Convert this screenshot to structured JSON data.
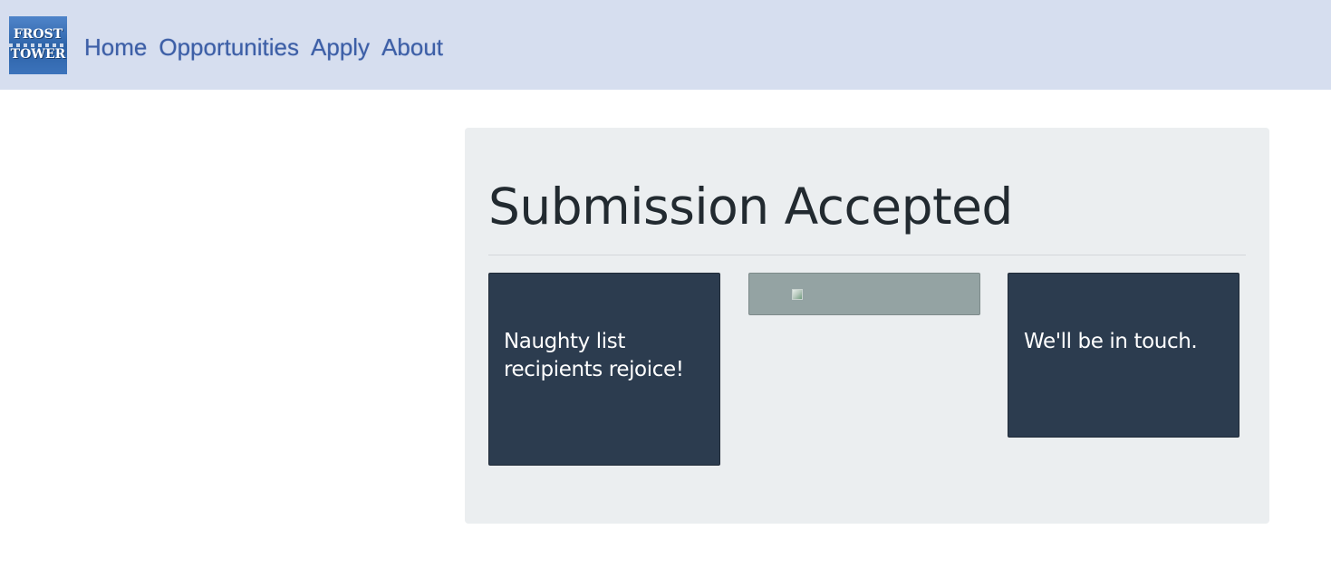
{
  "header": {
    "logo": {
      "line1": "FROST",
      "line2": "TOWER"
    },
    "nav": [
      "Home",
      "Opportunities",
      "Apply",
      "About"
    ]
  },
  "main": {
    "title": "Submission Accepted",
    "cards": [
      {
        "text": "Naughty list recipients rejoice!"
      },
      {
        "text": "We'll be in touch."
      }
    ],
    "image": {
      "alt": ""
    }
  },
  "colors": {
    "navbar_bg": "#d6deef",
    "nav_link": "#3d5fa6",
    "panel_bg": "#ebeef0",
    "card_bg": "#2c3c4f",
    "image_slot_bg": "#94a3a3"
  }
}
